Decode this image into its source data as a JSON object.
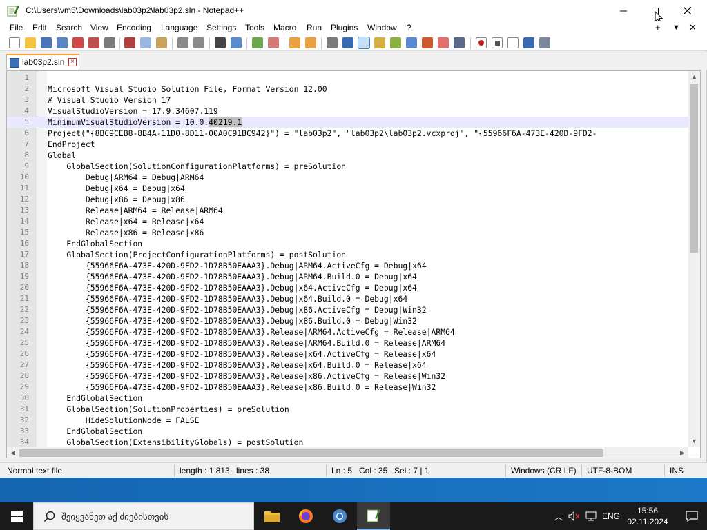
{
  "window": {
    "title": "C:\\Users\\vm5\\Downloads\\lab03p2\\lab03p2.sln - Notepad++"
  },
  "menu": {
    "items": [
      "File",
      "Edit",
      "Search",
      "View",
      "Encoding",
      "Language",
      "Settings",
      "Tools",
      "Macro",
      "Run",
      "Plugins",
      "Window",
      "?"
    ],
    "right_controls": [
      "+",
      "▼",
      "✕"
    ]
  },
  "tab": {
    "label": "lab03p2.sln"
  },
  "editor": {
    "current_line": 5,
    "lines": [
      "",
      "Microsoft Visual Studio Solution File, Format Version 12.00",
      "# Visual Studio Version 17",
      "VisualStudioVersion = 17.9.34607.119",
      "MinimumVisualStudioVersion = 10.0.40219.1",
      "Project(\"{8BC9CEB8-8B4A-11D0-8D11-00A0C91BC942}\") = \"lab03p2\", \"lab03p2\\lab03p2.vcxproj\", \"{55966F6A-473E-420D-9FD2-",
      "EndProject",
      "Global",
      "    GlobalSection(SolutionConfigurationPlatforms) = preSolution",
      "        Debug|ARM64 = Debug|ARM64",
      "        Debug|x64 = Debug|x64",
      "        Debug|x86 = Debug|x86",
      "        Release|ARM64 = Release|ARM64",
      "        Release|x64 = Release|x64",
      "        Release|x86 = Release|x86",
      "    EndGlobalSection",
      "    GlobalSection(ProjectConfigurationPlatforms) = postSolution",
      "        {55966F6A-473E-420D-9FD2-1D78B50EAAA3}.Debug|ARM64.ActiveCfg = Debug|x64",
      "        {55966F6A-473E-420D-9FD2-1D78B50EAAA3}.Debug|ARM64.Build.0 = Debug|x64",
      "        {55966F6A-473E-420D-9FD2-1D78B50EAAA3}.Debug|x64.ActiveCfg = Debug|x64",
      "        {55966F6A-473E-420D-9FD2-1D78B50EAAA3}.Debug|x64.Build.0 = Debug|x64",
      "        {55966F6A-473E-420D-9FD2-1D78B50EAAA3}.Debug|x86.ActiveCfg = Debug|Win32",
      "        {55966F6A-473E-420D-9FD2-1D78B50EAAA3}.Debug|x86.Build.0 = Debug|Win32",
      "        {55966F6A-473E-420D-9FD2-1D78B50EAAA3}.Release|ARM64.ActiveCfg = Release|ARM64",
      "        {55966F6A-473E-420D-9FD2-1D78B50EAAA3}.Release|ARM64.Build.0 = Release|ARM64",
      "        {55966F6A-473E-420D-9FD2-1D78B50EAAA3}.Release|x64.ActiveCfg = Release|x64",
      "        {55966F6A-473E-420D-9FD2-1D78B50EAAA3}.Release|x64.Build.0 = Release|x64",
      "        {55966F6A-473E-420D-9FD2-1D78B50EAAA3}.Release|x86.ActiveCfg = Release|Win32",
      "        {55966F6A-473E-420D-9FD2-1D78B50EAAA3}.Release|x86.Build.0 = Release|Win32",
      "    EndGlobalSection",
      "    GlobalSection(SolutionProperties) = preSolution",
      "        HideSolutionNode = FALSE",
      "    EndGlobalSection",
      "    GlobalSection(ExtensibilityGlobals) = postSolution"
    ],
    "selection": {
      "line": 5,
      "text": "40219.1"
    }
  },
  "status": {
    "file_type": "Normal text file",
    "length": "length : 1 813",
    "lines": "lines : 38",
    "ln": "Ln : 5",
    "col": "Col : 35",
    "sel": "Sel : 7 | 1",
    "eol": "Windows (CR LF)",
    "encoding": "UTF-8-BOM",
    "mode": "INS"
  },
  "taskbar": {
    "search_placeholder": "შეიყვანეთ აქ ძიებისთვის",
    "language": "ENG",
    "time": "15:56",
    "date": "02.11.2024"
  },
  "colors": {
    "accent": "#3b6fb4",
    "tab_accent": "#f8a030",
    "current_line_bg": "#e8e8ff",
    "selection_bg": "#c0c0c0",
    "taskbar_bg": "#1a1a1a"
  }
}
